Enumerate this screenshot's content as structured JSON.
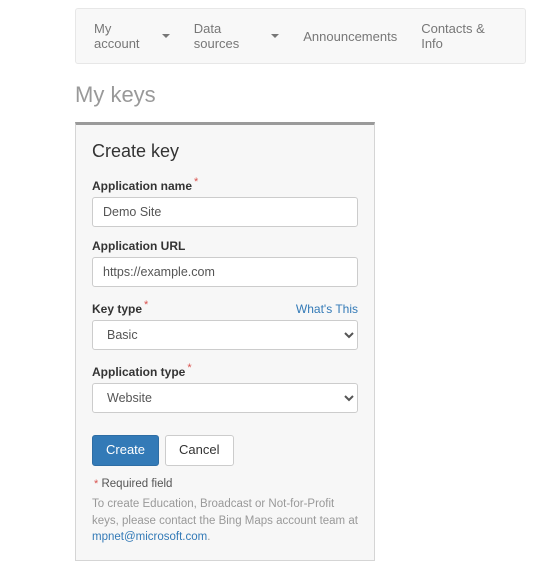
{
  "navbar": {
    "items": [
      {
        "label": "My account",
        "caret": true
      },
      {
        "label": "Data sources",
        "caret": true
      },
      {
        "label": "Announcements",
        "caret": false
      },
      {
        "label": "Contacts & Info",
        "caret": false
      }
    ]
  },
  "page": {
    "title": "My keys"
  },
  "panel": {
    "title": "Create key",
    "fields": {
      "app_name": {
        "label": "Application name",
        "value": "Demo Site"
      },
      "app_url": {
        "label": "Application URL",
        "value": "https://example.com"
      },
      "key_type": {
        "label": "Key type",
        "value": "Basic",
        "help_link": "What's This"
      },
      "app_type": {
        "label": "Application type",
        "value": "Website"
      }
    },
    "buttons": {
      "create": "Create",
      "cancel": "Cancel"
    },
    "required_note": "Required field",
    "help_text": "To create Education, Broadcast or Not-for-Profit keys, please contact the Bing Maps account team at ",
    "help_email": "mpnet@microsoft.com"
  }
}
